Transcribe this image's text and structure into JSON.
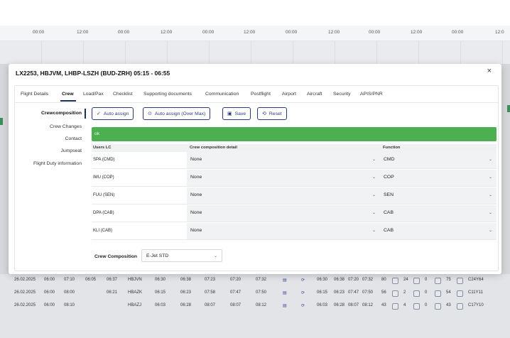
{
  "timeline": {
    "ticks": [
      "00:00",
      "12:00",
      "00:00",
      "12:00",
      "00:00",
      "12:00",
      "00:00",
      "12:00",
      "00:00",
      "12:00",
      "00:00",
      "12:0"
    ]
  },
  "dialog": {
    "title": "LX2253, HBJVM, LHBP-LSZH (BUD-ZRH) 05:15 - 06:55",
    "close_icon": "×",
    "tabs": [
      "Flight Details",
      "Crew",
      "Load/Pax",
      "Checklist",
      "Supporting documents",
      "Communication",
      "Postflight",
      "Airport",
      "Aircraft",
      "Security",
      "APIS/PNR"
    ],
    "active_tab": "Crew",
    "side_nav": [
      "Crewcomposition",
      "Crew Changes",
      "Contact",
      "Jumpseat",
      "Flight Duty information"
    ],
    "toolbar": {
      "auto_assign": "Auto assign",
      "auto_assign_over_max": "Auto assign (Over Max)",
      "save": "Save",
      "reset": "Reset"
    },
    "status_message": "ok",
    "table": {
      "headers": [
        "Users LC",
        "Crew composition detail",
        "Function"
      ],
      "rows": [
        {
          "label": "SPA (CMD)",
          "detail": "None",
          "function": "CMD"
        },
        {
          "label": "IMU (COP)",
          "detail": "None",
          "function": "COP"
        },
        {
          "label": "FUU (SEN)",
          "detail": "None",
          "function": "SEN"
        },
        {
          "label": "DPA (CAB)",
          "detail": "None",
          "function": "CAB"
        },
        {
          "label": "KLI (CAB)",
          "detail": "None",
          "function": "CAB"
        }
      ]
    },
    "crew_composition": {
      "label": "Crew Composition",
      "value": "E-Jet STD"
    }
  },
  "background_rows": [
    [
      "26.02.2025",
      "06:00",
      "07:10",
      "06:05",
      "06:37",
      "HBJVN",
      "06:30",
      "06:38",
      "07:23",
      "07:20",
      "07:32",
      "06:30",
      "06:38",
      "07:20",
      "07:32",
      "80",
      "24",
      "0",
      "75",
      "C24Y64"
    ],
    [
      "26.02.2025",
      "06:00",
      "08:00",
      "",
      "06:21",
      "HBAZK",
      "06:15",
      "06:23",
      "07:58",
      "07:47",
      "07:50",
      "06:15",
      "06:23",
      "07:47",
      "07:50",
      "56",
      "2",
      "0",
      "54",
      "C11Y11"
    ],
    [
      "26.02.2025",
      "06:00",
      "08:10",
      "",
      "",
      "HBAZJ",
      "06:03",
      "06:28",
      "08:07",
      "08:07",
      "08:12",
      "06:03",
      "06:28",
      "08:07",
      "08:12",
      "43",
      "4",
      "0",
      "43",
      "C17Y10"
    ]
  ],
  "colors": {
    "ok_bar": "#4caf50",
    "accent": "#2b3a77",
    "status_icon": "#3a4a9a"
  }
}
